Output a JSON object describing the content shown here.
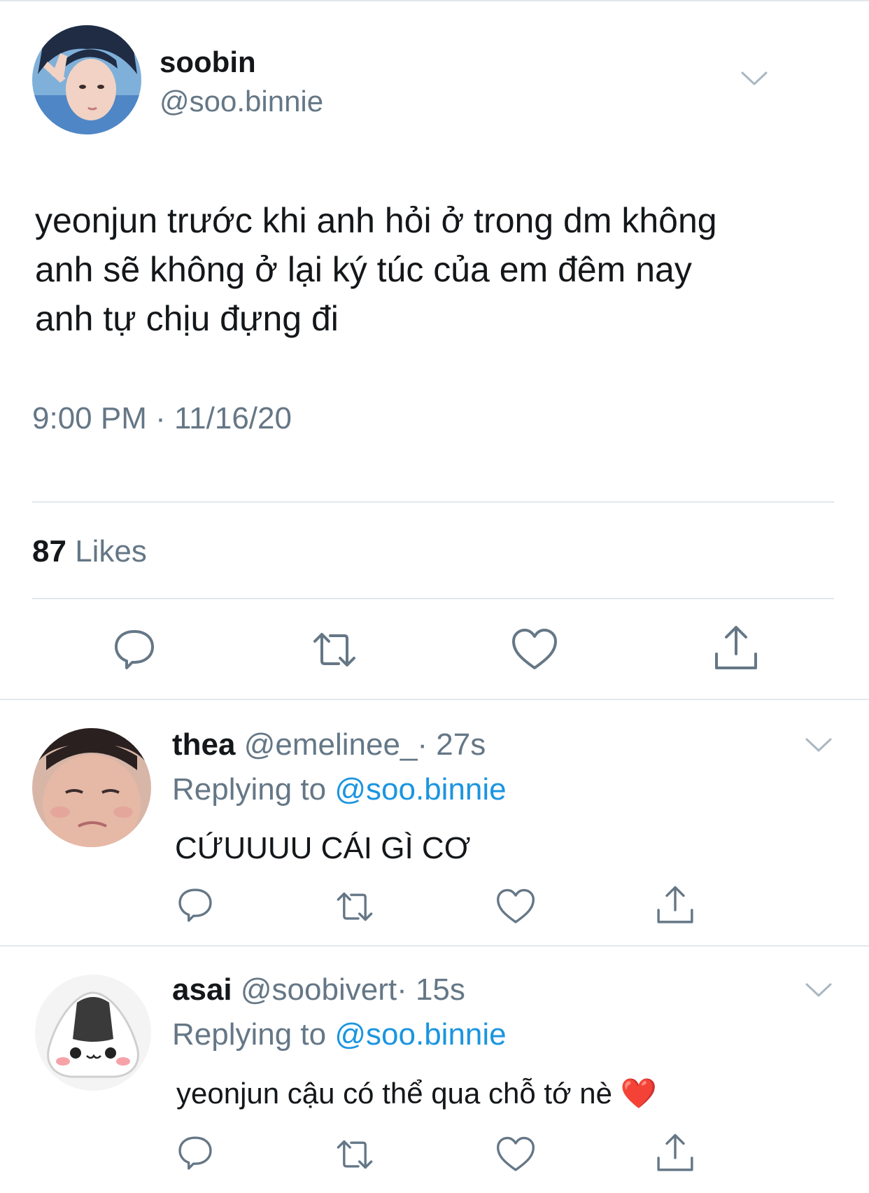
{
  "main_tweet": {
    "display_name": "soobin",
    "handle": "@soo.binnie",
    "text_lines": [
      "yeonjun trước khi anh hỏi ở trong dm không",
      "anh sẽ không ở lại ký túc của em đêm nay",
      "anh tự chịu đựng đi"
    ],
    "timestamp": "9:00 PM · 11/16/20",
    "likes_count": "87",
    "likes_label": "Likes",
    "icons": [
      "reply-icon",
      "retweet-icon",
      "like-icon",
      "share-icon"
    ]
  },
  "replies": [
    {
      "display_name": "thea",
      "handle": "@emelinee_",
      "time": "· 27s",
      "replying_prefix": "Replying to",
      "replying_handle": "@soo.binnie",
      "text": "CỨUUUU CÁI GÌ CƠ"
    },
    {
      "display_name": "asai",
      "handle": "@soobivert",
      "time": "· 15s",
      "replying_prefix": "Replying to",
      "replying_handle": "@soo.binnie",
      "text": "yeonjun cậu có thể qua chỗ tớ nè",
      "emoji": "❤️"
    }
  ],
  "colors": {
    "text": "#14171a",
    "secondary": "#657786",
    "link": "#1b95e0",
    "divider": "#e1e8ed",
    "heart_emoji": "#e0245e"
  }
}
